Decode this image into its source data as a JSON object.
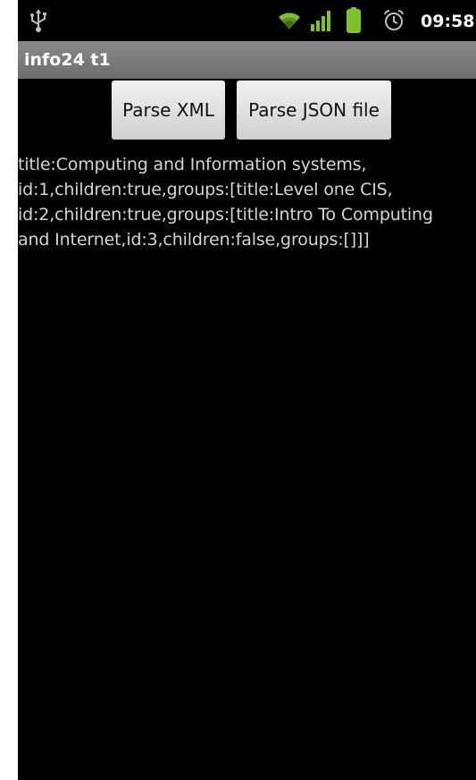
{
  "status_bar": {
    "time": "09:58",
    "icons": [
      "usb-icon",
      "wifi-icon",
      "signal-icon",
      "battery-icon",
      "alarm-icon"
    ],
    "colors": {
      "icon_green": "#7ec12e",
      "icon_gray": "#bdbdbd"
    }
  },
  "title_bar": {
    "title": "info24 t1"
  },
  "buttons": {
    "parse_xml": "Parse XML",
    "parse_json": "Parse JSON file"
  },
  "output": {
    "lines": [
      "title:Computing and Information systems,",
      "id:1,children:true,groups:[title:Level one CIS,",
      "id:2,children:true,groups:[title:Intro To Computing",
      "and Internet,id:3,children:false,groups:[]]]"
    ]
  }
}
